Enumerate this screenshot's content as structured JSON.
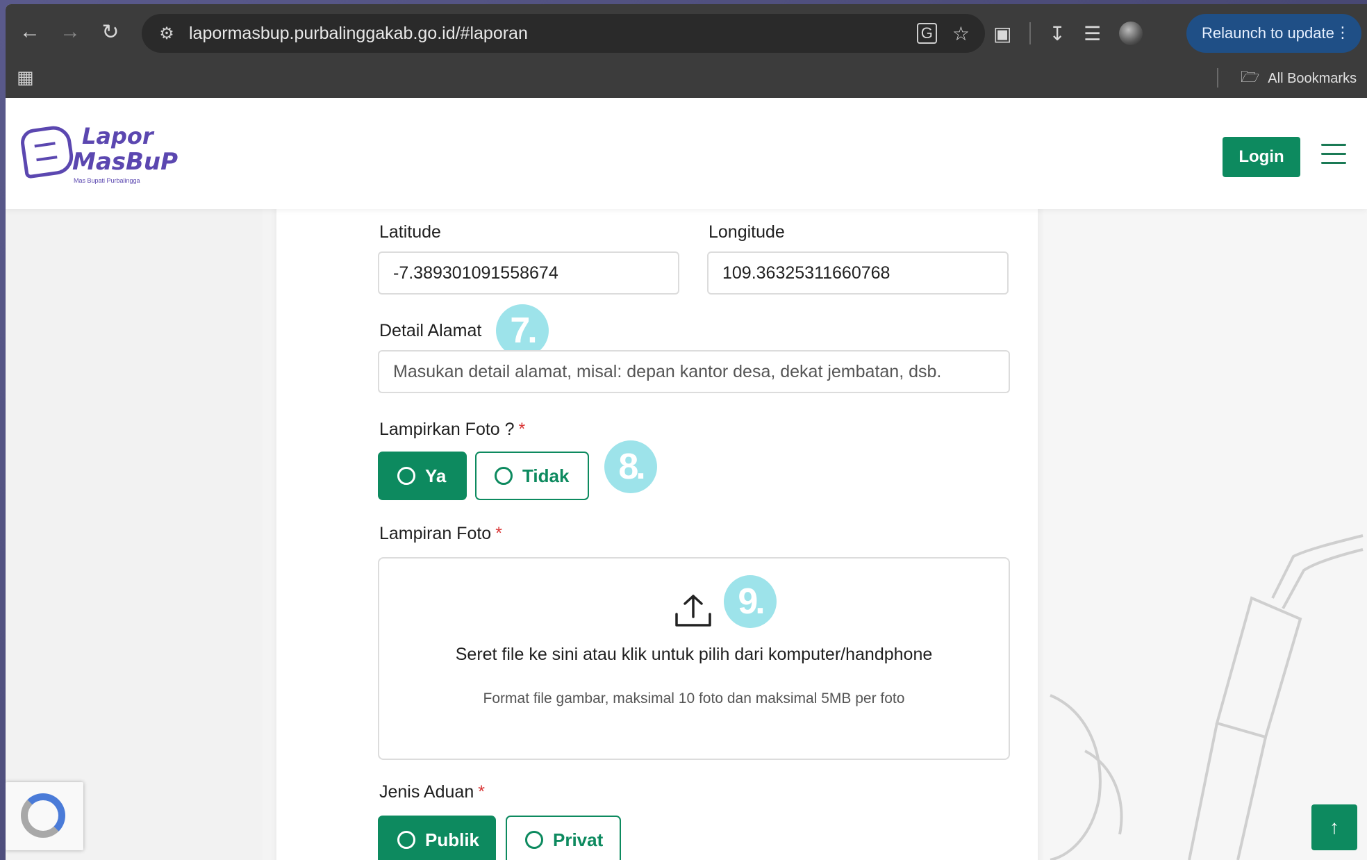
{
  "browser": {
    "url": "lapormasbup.purbalinggakab.go.id/#laporan",
    "relaunch_label": "Relaunch to update",
    "all_bookmarks": "All Bookmarks"
  },
  "header": {
    "logo_line1": "Lapor",
    "logo_line2": "MasBuP",
    "logo_tagline": "Mas Bupati Purbalingga",
    "login_label": "Login"
  },
  "form": {
    "latitude": {
      "label": "Latitude",
      "value": "-7.389301091558674"
    },
    "longitude": {
      "label": "Longitude",
      "value": "109.36325311660768"
    },
    "detail_alamat": {
      "label": "Detail Alamat",
      "placeholder": "Masukan detail alamat, misal: depan kantor desa, dekat jembatan, dsb."
    },
    "lampirkan_foto": {
      "label": "Lampirkan Foto ?",
      "required_mark": "*",
      "options": [
        "Ya",
        "Tidak"
      ],
      "selected": "Ya"
    },
    "lampiran_foto": {
      "label": "Lampiran Foto",
      "required_mark": "*",
      "dropzone_text": "Seret file ke sini atau klik untuk pilih dari komputer/handphone",
      "dropzone_hint": "Format file gambar, maksimal 10 foto dan maksimal 5MB per foto"
    },
    "jenis_aduan": {
      "label": "Jenis Aduan",
      "required_mark": "*",
      "options": [
        "Publik",
        "Privat"
      ],
      "selected": "Publik"
    }
  },
  "step_badges": [
    "7.",
    "8.",
    "9."
  ],
  "colors": {
    "primary": "#0d8a5f",
    "brand": "#5b47b0",
    "badge": "#9de3ea",
    "required": "#d93636"
  }
}
